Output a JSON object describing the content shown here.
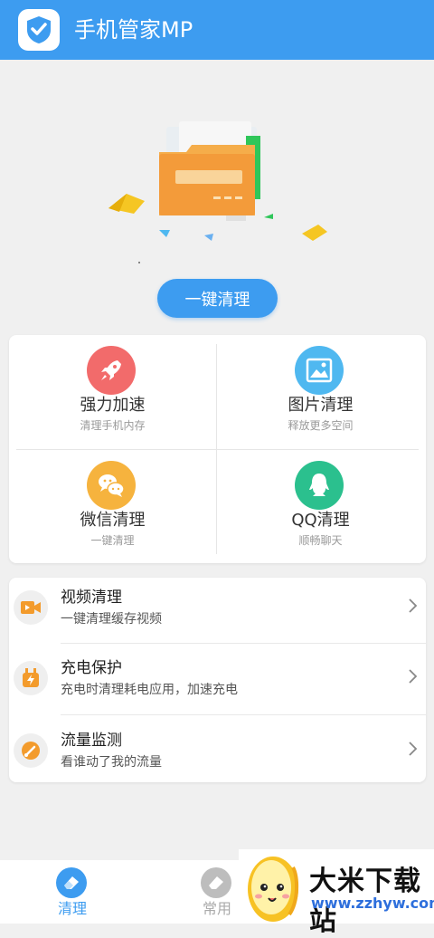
{
  "header": {
    "title": "手机管家MP",
    "background": "#3d9cf0",
    "icon": "shield-check-icon"
  },
  "hero": {
    "illustration": "folder-clean-illustration"
  },
  "main_action": {
    "label": "一键清理"
  },
  "features": [
    {
      "title": "强力加速",
      "subtitle": "清理手机内存",
      "icon": "rocket-icon",
      "color": "#f26b6b"
    },
    {
      "title": "图片清理",
      "subtitle": "释放更多空间",
      "icon": "image-icon",
      "color": "#4fb8f0"
    },
    {
      "title": "微信清理",
      "subtitle": "一键清理",
      "icon": "wechat-icon",
      "color": "#f6b33e"
    },
    {
      "title": "QQ清理",
      "subtitle": "顺畅聊天",
      "icon": "qq-icon",
      "color": "#2bc08e"
    }
  ],
  "tools": [
    {
      "title": "视频清理",
      "subtitle": "一键清理缓存视频",
      "icon": "video-icon"
    },
    {
      "title": "充电保护",
      "subtitle": "充电时清理耗电应用，加速充电",
      "icon": "charging-icon"
    },
    {
      "title": "流量监测",
      "subtitle": "看谁动了我的流量",
      "icon": "gauge-icon"
    }
  ],
  "tabs": [
    {
      "label": "清理",
      "active": true,
      "icon": "eraser-icon"
    },
    {
      "label": "常用",
      "active": false,
      "icon": "common-icon"
    }
  ],
  "watermark": {
    "name": "大米下载站",
    "url": "www.zzhyw.com"
  }
}
